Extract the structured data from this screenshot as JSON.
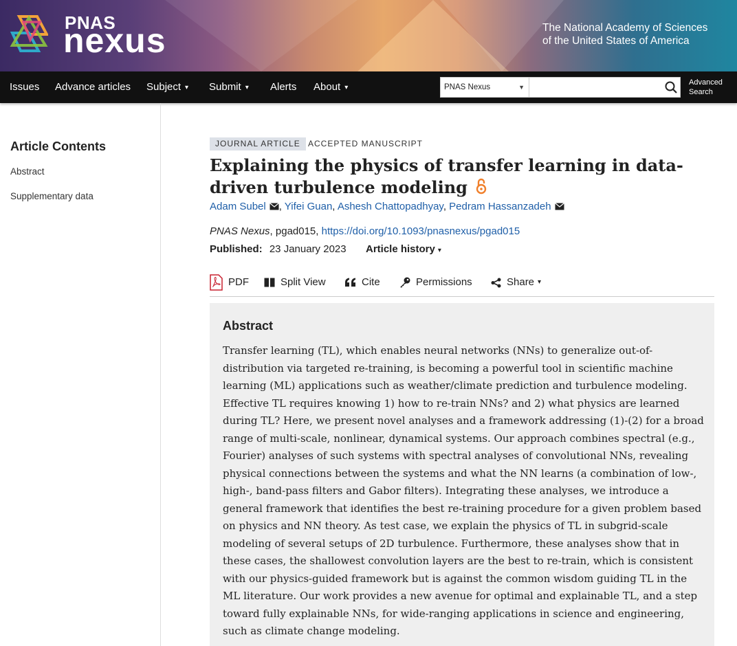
{
  "header": {
    "logo_top": "PNAS",
    "logo_bottom": "nexus",
    "publisher_line1": "The National Academy of Sciences",
    "publisher_line2": "of the United States of America"
  },
  "nav": {
    "items": [
      {
        "label": "Issues",
        "dropdown": false
      },
      {
        "label": "Advance articles",
        "dropdown": false
      },
      {
        "label": "Subject",
        "dropdown": true
      },
      {
        "label": "Submit",
        "dropdown": true
      },
      {
        "label": "Alerts",
        "dropdown": false
      },
      {
        "label": "About",
        "dropdown": true
      }
    ],
    "search_scope": "PNAS Nexus",
    "search_placeholder": "",
    "advanced_search": [
      "Advanced",
      "Search"
    ],
    "caret": "▾"
  },
  "sidebar": {
    "title": "Article Contents",
    "items": [
      "Abstract",
      "Supplementary data"
    ]
  },
  "article": {
    "type_badge": "JOURNAL ARTICLE",
    "status_badge": "ACCEPTED MANUSCRIPT",
    "title": "Explaining the physics of transfer learning in data-driven turbulence modeling",
    "authors": [
      {
        "name": "Adam Subel",
        "email_icon": true
      },
      {
        "name": "Yifei Guan",
        "email_icon": false
      },
      {
        "name": "Ashesh Chattopadhyay",
        "email_icon": false
      },
      {
        "name": "Pedram Hassanzadeh",
        "email_icon": true
      }
    ],
    "journal": "PNAS Nexus",
    "article_id": ", pgad015, ",
    "doi": "https://doi.org/10.1093/pnasnexus/pgad015",
    "published_label": "Published:",
    "published_date": "23 January 2023",
    "history_label": "Article history"
  },
  "toolbar": {
    "pdf": "PDF",
    "split_view": "Split View",
    "cite": "Cite",
    "permissions": "Permissions",
    "share": "Share"
  },
  "abstract": {
    "heading": "Abstract",
    "text": "Transfer learning (TL), which enables neural networks (NNs) to generalize out-of-distribution via targeted re-training, is becoming a powerful tool in scientific machine learning (ML) applications such as weather/climate prediction and turbulence modeling. Effective TL requires knowing 1) how to re-train NNs? and 2) what physics are learned during TL? Here, we present novel analyses and a framework addressing (1)-(2) for a broad range of multi-scale, nonlinear, dynamical systems. Our approach combines spectral (e.g., Fourier) analyses of such systems with spectral analyses of convolutional NNs, revealing physical connections between the systems and what the NN learns (a combination of low-, high-, band-pass filters and Gabor filters). Integrating these analyses, we introduce a general framework that identifies the best re-training procedure for a given problem based on physics and NN theory. As test case, we explain the physics of TL in subgrid-scale modeling of several setups of 2D turbulence. Furthermore, these analyses show that in these cases, the shallowest convolution layers are the best to re-train, which is consistent with our physics-guided framework but is against the common wisdom guiding TL in the ML literature. Our work provides a new avenue for optimal and explainable TL, and a step toward fully explainable NNs, for wide-ranging applications in science and engineering, such as climate change modeling."
  },
  "colors": {
    "link": "#1f5fa8",
    "navbar": "#111111",
    "open_access": "#f07f2a",
    "pdf_red": "#c8202f",
    "abstract_bg": "#efefef"
  }
}
